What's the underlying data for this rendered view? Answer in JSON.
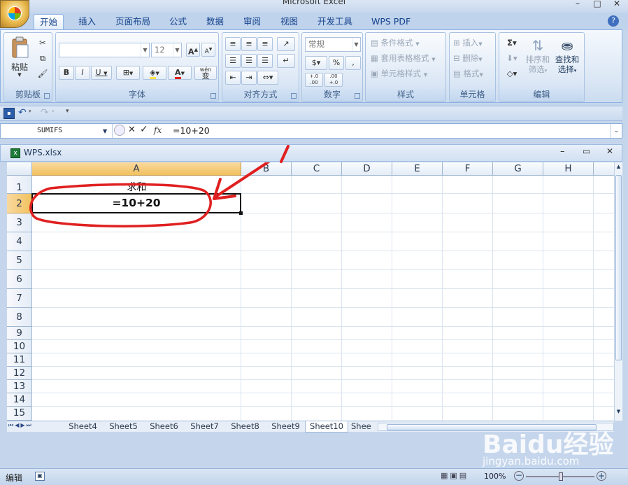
{
  "app_title": "Microsoft Excel",
  "ribbon_tabs": [
    "开始",
    "插入",
    "页面布局",
    "公式",
    "数据",
    "审阅",
    "视图",
    "开发工具",
    "WPS PDF"
  ],
  "ribbon": {
    "clipboard": {
      "paste_label": "粘贴",
      "group_label": "剪贴板"
    },
    "font": {
      "font_size_placeholder": "12",
      "group_label": "字体",
      "bold": "B",
      "italic": "I",
      "underline": "U",
      "grow": "A",
      "shrink": "A",
      "font_color": "A",
      "wen": "wén",
      "bian": "变"
    },
    "alignment": {
      "group_label": "对齐方式"
    },
    "number": {
      "format_value": "常规",
      "percent": "%",
      "comma": ",",
      "inc_decimal": "+.0 .00",
      "dec_decimal": ".00 +.0",
      "group_label": "数字"
    },
    "styles": {
      "conditional_format": "条件格式",
      "format_as_table": "套用表格格式",
      "cell_styles": "单元格样式",
      "group_label": "样式"
    },
    "cells": {
      "insert": "插入",
      "delete": "删除",
      "format": "格式",
      "group_label": "单元格"
    },
    "editing": {
      "sort_filter_1": "排序和",
      "sort_filter_2": "筛选",
      "find_select_1": "查找和",
      "find_select_2": "选择",
      "group_label": "编辑"
    }
  },
  "formula_bar": {
    "name_box": "SUMIFS",
    "fx": "fx",
    "content": "=10+20"
  },
  "workbook": {
    "name": "WPS.xlsx"
  },
  "columns": [
    "A",
    "B",
    "C",
    "D",
    "E",
    "F",
    "G",
    "H"
  ],
  "rows": [
    "1",
    "2",
    "3",
    "4",
    "5",
    "6",
    "7",
    "8",
    "9",
    "10",
    "11",
    "12",
    "13",
    "14",
    "15"
  ],
  "cells": {
    "A1": "求和",
    "A2": "=10+20"
  },
  "sheet_tabs": [
    "Sheet4",
    "Sheet5",
    "Sheet6",
    "Sheet7",
    "Sheet8",
    "Sheet9",
    "Sheet10",
    "Shee"
  ],
  "status": {
    "mode": "编辑",
    "zoom": "100%"
  },
  "watermark": {
    "brand": "Baidu经验",
    "url": "jingyan.baidu.com"
  }
}
